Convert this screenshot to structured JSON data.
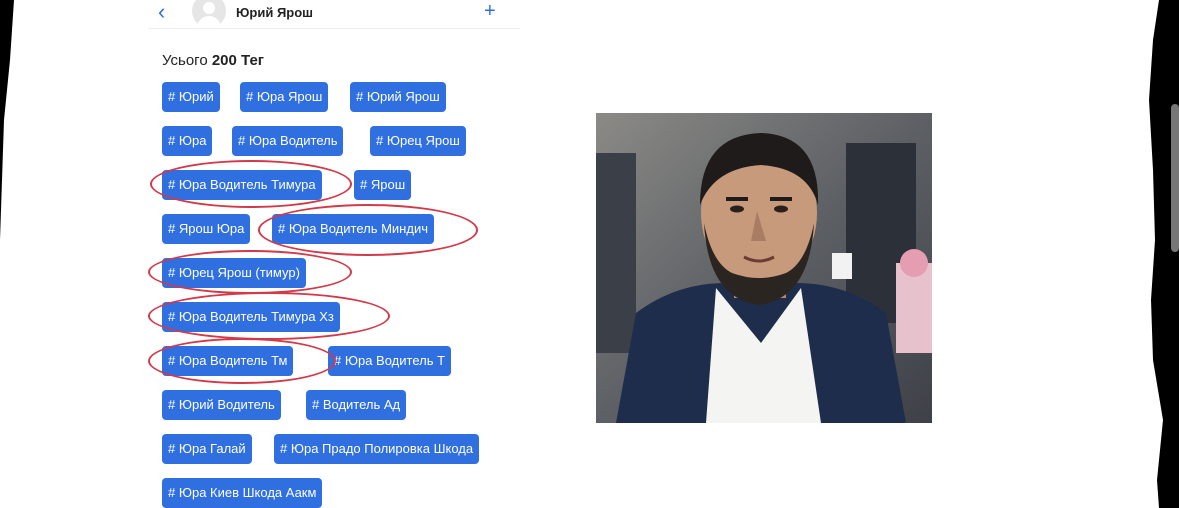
{
  "header": {
    "back_icon": "chevron-left-icon",
    "name": "Юрий Ярош",
    "plus_icon": "plus-icon"
  },
  "summary": {
    "prefix": "Усього",
    "count": "200",
    "unit": "Тег"
  },
  "tags": [
    "# Юрий",
    "# Юра Ярош",
    "# Юрий Ярош",
    "# Юра",
    "# Юра Водитель",
    "# Юрец Ярош",
    "# Юра Водитель Тимура",
    "# Ярош",
    "# Ярош Юра",
    "# Юра Водитель Миндич",
    "# Юрец Ярош (тимур)",
    "# Юра Водитель Тимура Хз",
    "# Юра Водитель Тм",
    "# Юра Водитель Т",
    "# Юрий Водитель",
    "# Водитель Ад",
    "# Юра Галай",
    "# Юра Прадо Полировка Шкода",
    "# Юра Киев Шкода Аакм"
  ],
  "colors": {
    "tag_bg": "#2f6fe0",
    "accent": "#2f6fe0",
    "highlight_ring": "#d23a4a"
  },
  "photo": {
    "description_icon": "portrait-photo"
  }
}
